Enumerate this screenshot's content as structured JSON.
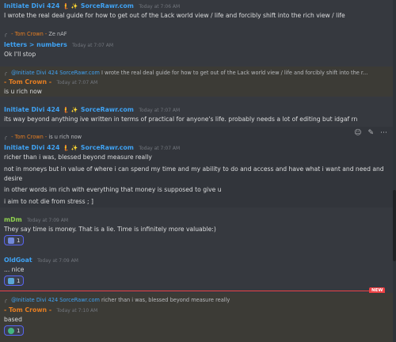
{
  "messages": {
    "m1": {
      "author": "Initiate Divi 424",
      "tags": "🧜 ✨",
      "mention": "SorceRawr.com",
      "time": "Today at 7:06 AM",
      "text": "I wrote the real deal guide for how to get out of the Lack world view / life and forcibly shift into the rich view / life"
    },
    "m2": {
      "reply_author": "- Tom Crown -",
      "reply_text": "Ze nAF",
      "author": "letters > numbers",
      "time": "Today at 7:07 AM",
      "text": "Ok I'll stop"
    },
    "m3": {
      "reply_author": "@Initiate Divi 424",
      "reply_mention": "SorceRawr.com",
      "reply_text": "I wrote the real deal guide for how to get out of the Lack world view / life and forcibly shift into the r...",
      "author": "- Tom Crown -",
      "time": "Today at 7:07 AM",
      "text": "is u rich now"
    },
    "m4": {
      "author": "Initiate Divi 424",
      "mention": "SorceRawr.com",
      "time": "Today at 7:07 AM",
      "text": "its way beyond anything ive written in terms of practical for anyone's life. probably needs a lot of editing but idgaf rn"
    },
    "m5": {
      "reply_author": "- Tom Crown -",
      "reply_text": "is u rich now",
      "author": "Initiate Divi 424",
      "mention": "SorceRawr.com",
      "time": "Today at 7:07 AM",
      "lines": [
        "richer than i was, blessed beyond measure really",
        "not in moneys but in value of where i can spend my time and my ability to do and access and have what i want and need and",
        "desire",
        "in other words im rich with everything that money is supposed to give u",
        "i aim to not die from stress ; ]"
      ]
    },
    "m6": {
      "author": "mDm",
      "time": "Today at 7:09 AM",
      "text": "They say time is money. That is a lie. Time is infinitely more valuable:)",
      "reaction_count": "1"
    },
    "m7": {
      "author": "OldGoat",
      "time": "Today at 7:09 AM",
      "text": "... nice",
      "reaction_count": "1"
    },
    "m8": {
      "reply_author": "@Initiate Divi 424",
      "reply_mention": "SorceRawr.com",
      "reply_text": "richer than i was, blessed beyond measure really",
      "author": "- Tom Crown -",
      "time": "Today at 7:10 AM",
      "text": "based",
      "reaction_count": "1"
    }
  },
  "new_label": "NEW",
  "colors": {
    "background": "#36393f",
    "mention_name": "#3fa2f3",
    "tom_crown": "#e67e22",
    "mdm": "#8fd14f",
    "reaction_border": "#5865f2",
    "new_divider": "#ed4245"
  }
}
